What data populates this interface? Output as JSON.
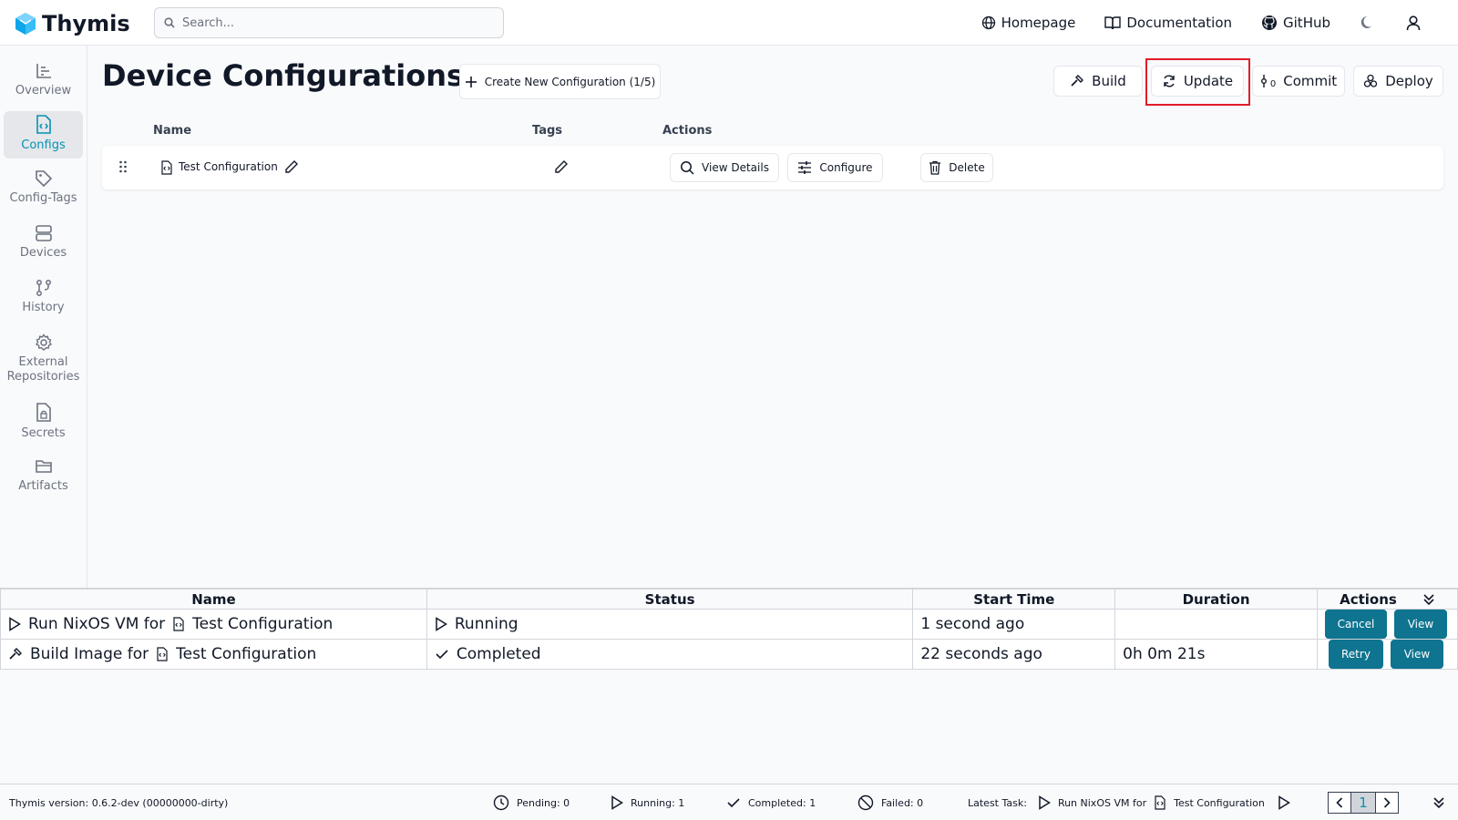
{
  "header": {
    "app_name": "Thymis",
    "search_placeholder": "Search...",
    "links": [
      {
        "label": "Homepage",
        "icon": "globe-icon"
      },
      {
        "label": "Documentation",
        "icon": "book-icon"
      },
      {
        "label": "GitHub",
        "icon": "github-icon"
      }
    ]
  },
  "sidebar": {
    "items": [
      {
        "label": "Overview",
        "icon": "chart-icon"
      },
      {
        "label": "Configs",
        "icon": "file-code-icon",
        "active": true
      },
      {
        "label": "Config-Tags",
        "icon": "tag-icon"
      },
      {
        "label": "Devices",
        "icon": "server-icon"
      },
      {
        "label": "History",
        "icon": "git-branch-icon"
      },
      {
        "label": "External Repositories",
        "icon": "gear-icon"
      },
      {
        "label": "Secrets",
        "icon": "file-lock-icon"
      },
      {
        "label": "Artifacts",
        "icon": "folder-icon"
      }
    ]
  },
  "main": {
    "title": "Device Configurations",
    "create_button": "Create New Configuration (1/5)",
    "toolbar": {
      "build": "Build",
      "update": "Update",
      "commit": "Commit",
      "commit_count": "0",
      "deploy": "Deploy"
    },
    "table": {
      "headers": [
        "Name",
        "Tags",
        "Actions"
      ],
      "rows": [
        {
          "name": "Test Configuration",
          "actions": {
            "view": "View Details",
            "configure": "Configure",
            "delete": "Delete"
          }
        }
      ]
    }
  },
  "tasks": {
    "headers": [
      "Name",
      "Status",
      "Start Time",
      "Duration",
      "Actions"
    ],
    "rows": [
      {
        "prefix": "Run NixOS VM for",
        "config": "Test Configuration",
        "status": "Running",
        "start": "1 second ago",
        "duration": "",
        "btn1": "Cancel",
        "btn2": "View"
      },
      {
        "prefix": "Build Image for",
        "config": "Test Configuration",
        "status": "Completed",
        "start": "22 seconds ago",
        "duration": "0h 0m 21s",
        "btn1": "Retry",
        "btn2": "View"
      }
    ]
  },
  "statusbar": {
    "version": "Thymis version: 0.6.2-dev (00000000-dirty)",
    "pending": "Pending: 0",
    "running": "Running: 1",
    "completed": "Completed: 1",
    "failed": "Failed: 0",
    "latest_label": "Latest Task:",
    "latest_prefix": "Run NixOS VM for",
    "latest_config": "Test Configuration",
    "page": "1"
  },
  "colors": {
    "accent": "#0891b2",
    "action_button": "#0e7490",
    "highlight": "#e11d2a"
  }
}
